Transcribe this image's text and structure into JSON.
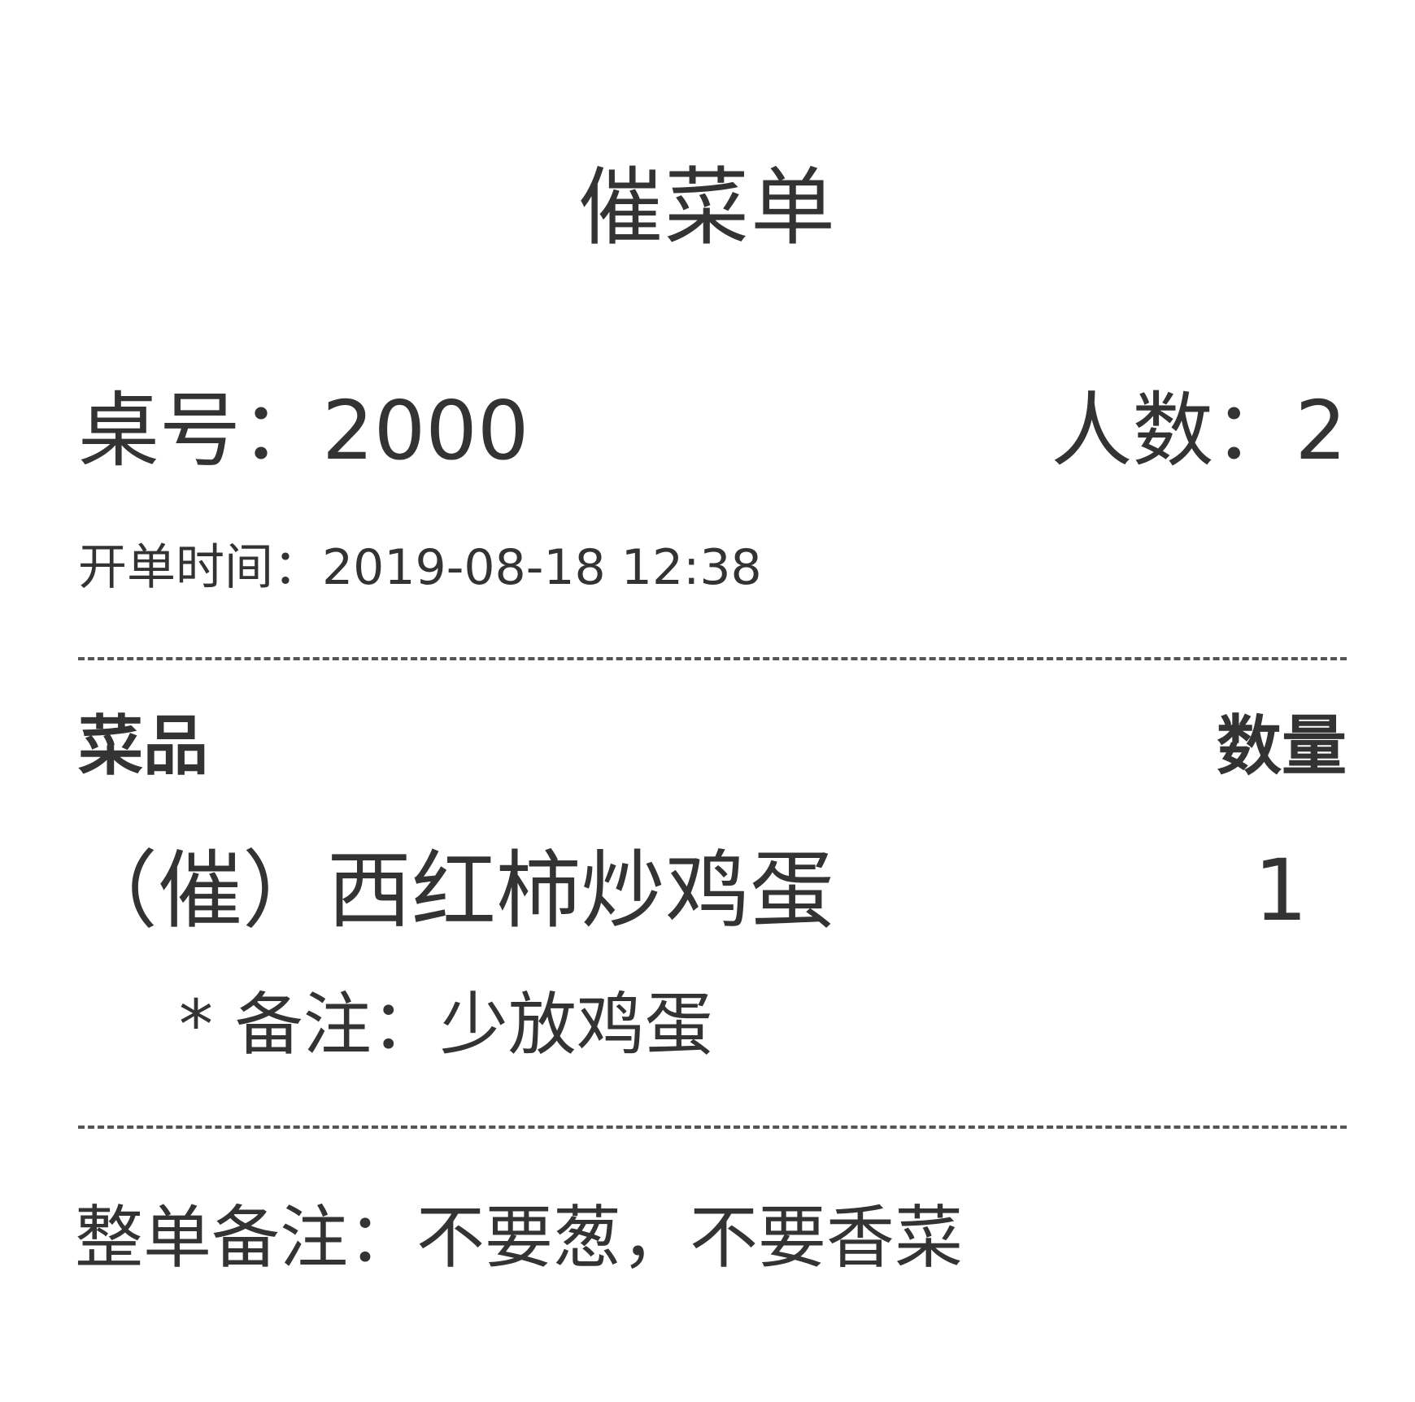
{
  "receipt": {
    "title": "催菜单",
    "table_label": "桌号：2000",
    "guests_label": "人数：2",
    "open_time_label": "开单时间：",
    "open_time_value": "2019-08-18 12:38",
    "columns": {
      "dish": "菜品",
      "quantity": "数量"
    },
    "items": [
      {
        "name": "（催）西红柿炒鸡蛋",
        "quantity": "1",
        "note": "* 备注：少放鸡蛋"
      }
    ],
    "order_note": "整单备注：不要葱，不要香菜"
  }
}
